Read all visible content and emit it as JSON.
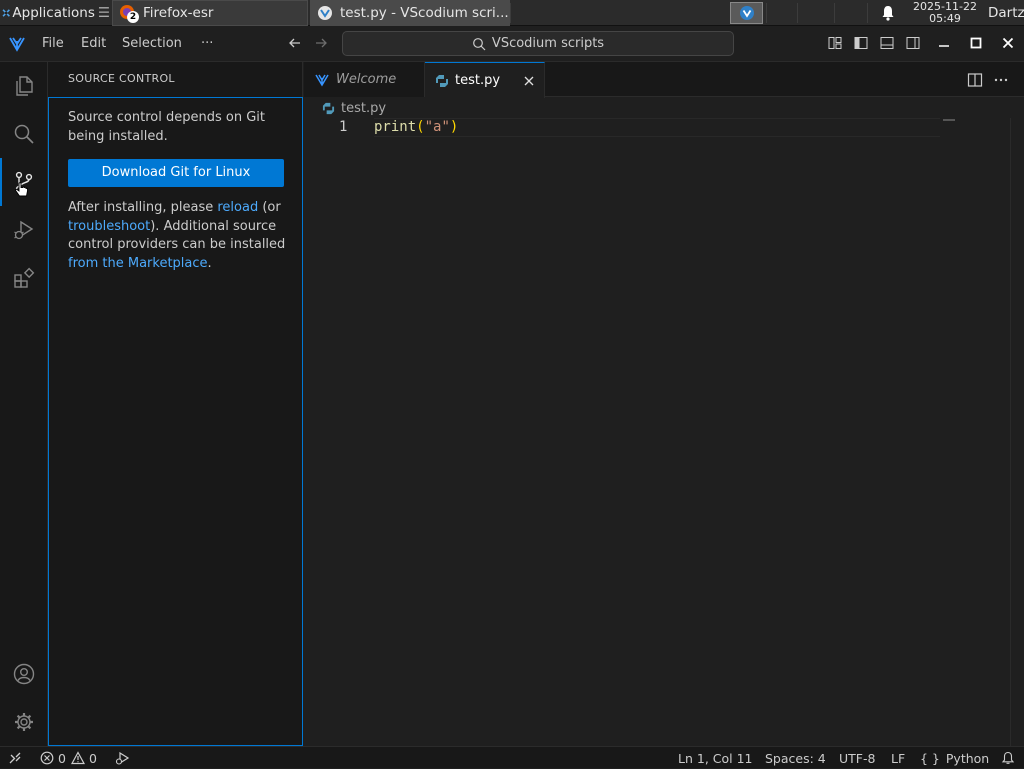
{
  "taskbar": {
    "apps_label": "Applications",
    "apps_suffix": "☰",
    "firefox_label": "Firefox-esr",
    "firefox_badge": "2",
    "vscodium_label": "test.py - VScodium scri...",
    "clock_date": "2025-11-22",
    "clock_time": "05:49",
    "user": "Dartz"
  },
  "titlebar": {
    "menu": [
      "File",
      "Edit",
      "Selection",
      "···"
    ],
    "command_center": "VScodium scripts"
  },
  "sidebar": {
    "title": "SOURCE CONTROL",
    "message": "Source control depends on Git being installed.",
    "button": "Download Git for Linux",
    "after": {
      "part1": "After installing, please ",
      "reload": "reload",
      "part2": " (or ",
      "troubleshoot": "troubleshoot",
      "part3": "). Additional source control providers can be installed ",
      "marketplace": "from the Marketplace",
      "part4": "."
    }
  },
  "tabs": [
    {
      "label": "Welcome",
      "active": false
    },
    {
      "label": "test.py",
      "active": true
    }
  ],
  "breadcrumb": "test.py",
  "editor": {
    "line_number": "1",
    "tokens": {
      "fn": "print",
      "open": "(",
      "str": "\"a\"",
      "close": ")"
    }
  },
  "statusbar": {
    "errors": "0",
    "warnings": "0",
    "position": "Ln 1, Col 11",
    "spaces": "Spaces: 4",
    "encoding": "UTF-8",
    "eol": "LF",
    "language_braces": "{ }",
    "language": "Python"
  },
  "colors": {
    "accent": "#0078d4",
    "link": "#4daafc",
    "background": "#1f1f1f",
    "sidebar_bg": "#181818"
  }
}
